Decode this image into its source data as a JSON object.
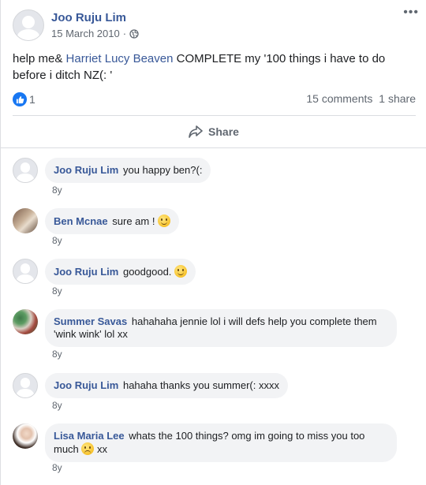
{
  "post": {
    "author": "Joo Ruju Lim",
    "date": "15 March 2010",
    "separator": "·",
    "text_before": "help me& ",
    "mention": "Harriet Lucy Beaven",
    "text_after": " COMPLETE my '100 things i have to do before i ditch NZ(: '",
    "like_count": "1",
    "comments_count": "15 comments",
    "shares_count": "1 share",
    "share_label": "Share",
    "more_label": "•••"
  },
  "comments": [
    {
      "name": "Joo Ruju Lim",
      "text": "you happy ben?(:",
      "time": "8y"
    },
    {
      "name": "Ben Mcnae",
      "text": "sure am !",
      "time": "8y",
      "emoji": "smile"
    },
    {
      "name": "Joo Ruju Lim",
      "text": "goodgood.",
      "time": "8y",
      "emoji": "smile"
    },
    {
      "name": "Summer Savas",
      "text": "hahahaha jennie lol i will defs help you complete them 'wink wink' lol xx",
      "time": "8y"
    },
    {
      "name": "Joo Ruju Lim",
      "text": "hahaha thanks you summer(: xxxx",
      "time": "8y"
    },
    {
      "name": "Lisa Maria Lee",
      "text": "whats the 100 things? omg im going to miss you too much",
      "text_end": "xx",
      "time": "8y",
      "emoji": "sad"
    }
  ],
  "colors": {
    "link": "#385898",
    "like_badge": "#1877f2",
    "bubble": "#f2f3f5",
    "muted": "#606770"
  }
}
